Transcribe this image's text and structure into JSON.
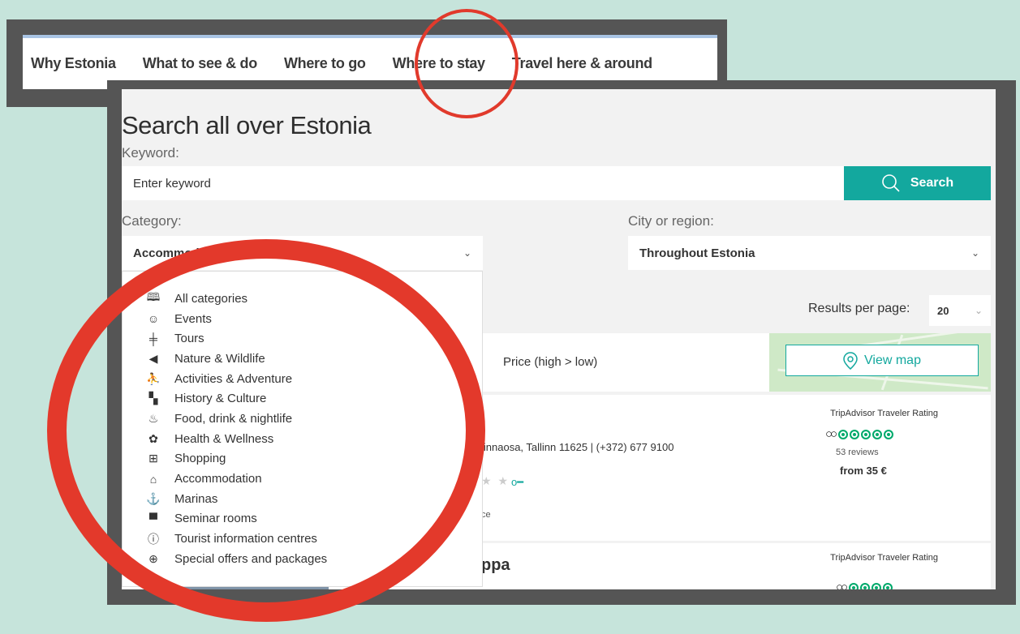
{
  "nav": {
    "items": [
      "Why Estonia",
      "What to see & do",
      "Where to go",
      "Where to stay",
      "Travel here & around"
    ]
  },
  "search": {
    "title": "Search all over Estonia",
    "keyword_label": "Keyword:",
    "keyword_placeholder": "Enter keyword",
    "search_button": "Search",
    "category_label": "Category:",
    "category_value": "Accommodation",
    "region_label": "City or region:",
    "region_value": "Throughout Estonia"
  },
  "results_controls": {
    "per_page_label": "Results per page:",
    "per_page_value": "20",
    "sort_price": "Price (high > low)",
    "view_map": "View map"
  },
  "dropdown": {
    "items": [
      {
        "label": "All categories",
        "icon": "book-icon"
      },
      {
        "label": "Events",
        "icon": "masks-icon"
      },
      {
        "label": "Tours",
        "icon": "signpost-icon"
      },
      {
        "label": "Nature & Wildlife",
        "icon": "leaf-icon"
      },
      {
        "label": "Activities & Adventure",
        "icon": "hiker-icon"
      },
      {
        "label": "History & Culture",
        "icon": "binoculars-icon"
      },
      {
        "label": "Food, drink & nightlife",
        "icon": "cutlery-icon"
      },
      {
        "label": "Health & Wellness",
        "icon": "lotus-icon"
      },
      {
        "label": "Shopping",
        "icon": "cart-icon"
      },
      {
        "label": "Accommodation",
        "icon": "bed-icon"
      },
      {
        "label": "Marinas",
        "icon": "anchor-icon"
      },
      {
        "label": "Seminar rooms",
        "icon": "presentation-icon"
      },
      {
        "label": "Tourist information centres",
        "icon": "info-icon"
      },
      {
        "label": "Special offers and packages",
        "icon": "gift-icon"
      }
    ]
  },
  "results": [
    {
      "address": "linnaosa, Tallinn 11625 | (+372) 677 9100",
      "tiny": "ce",
      "ta_label": "TripAdvisor Traveler Rating",
      "reviews": "53 reviews",
      "price": "from 35 €",
      "stars_shown": "★ ★"
    },
    {
      "title_fragment": "ppa",
      "ta_label": "TripAdvisor Traveler Rating"
    }
  ],
  "colors": {
    "accent": "#13a89e",
    "highlight": "#e3392b",
    "background": "#c6e4db"
  }
}
